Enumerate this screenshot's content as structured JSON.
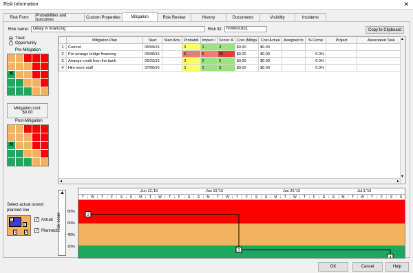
{
  "window": {
    "title": "Risk Information",
    "close": "✕"
  },
  "tabs": [
    {
      "label": "Risk Form",
      "active": false
    },
    {
      "label": "Probabilities and outcomes",
      "active": false
    },
    {
      "label": "Custom Properties",
      "active": false
    },
    {
      "label": "Mitigation",
      "active": true
    },
    {
      "label": "Risk Review",
      "active": false
    },
    {
      "label": "History",
      "active": false
    },
    {
      "label": "Documents",
      "active": false
    },
    {
      "label": "Visibility",
      "active": false
    },
    {
      "label": "Incidents",
      "active": false
    }
  ],
  "risk": {
    "name_label": "Risk name:",
    "name_value": "Delay in financing",
    "id_label": "Risk ID:",
    "id_value": "R00001831",
    "copy_button": "Copy to Clipboard"
  },
  "response": {
    "treat": "Treat",
    "opportunity": "Opportunity",
    "selected": "treat"
  },
  "pre_mitigation": {
    "title": "Pre-Mitigation",
    "cells": [
      [
        "orange",
        "orange",
        "red",
        "red",
        "red"
      ],
      [
        "orange",
        "orange",
        "orange",
        "red",
        "red"
      ],
      [
        "green",
        "orange",
        "orange",
        "red",
        "red"
      ],
      [
        "green",
        "green",
        "orange",
        "orange",
        "red"
      ],
      [
        "green",
        "green",
        "green",
        "orange",
        "orange"
      ]
    ],
    "marker": "✕"
  },
  "mitigation_cost": {
    "label": "Mitigation cost:",
    "value": "$0.00"
  },
  "post_mitigation": {
    "title": "Post-Mitigation",
    "cells": [
      [
        "orange",
        "orange",
        "red",
        "red",
        "red"
      ],
      [
        "orange",
        "orange",
        "orange",
        "red",
        "red"
      ],
      [
        "green",
        "orange",
        "orange",
        "red",
        "red"
      ],
      [
        "green",
        "green",
        "orange",
        "orange",
        "red"
      ],
      [
        "green",
        "green",
        "green",
        "orange",
        "orange"
      ]
    ],
    "marker": "✕"
  },
  "colors": {
    "red": "#ff0000",
    "orange": "#f4b25e",
    "green": "#1fa760",
    "yellow": "#ffff66",
    "lightgreen": "#9be37f",
    "salmon": "#f07b73",
    "darkred": "#e33a3a"
  },
  "table": {
    "headers": [
      "Mitigation Plan",
      "Start",
      "Start Actu",
      "Probabili",
      "Impact /",
      "Score: A",
      "Cost (Mitiga",
      "Cost Actual",
      "Assigned to",
      "% Comp",
      "Project",
      "Associated Task"
    ],
    "rows": [
      {
        "n": "1",
        "plan": "Current",
        "start": "05/09/16",
        "start_act": "",
        "prob": "3",
        "impact": "1",
        "score": "3",
        "cost": "$0.00",
        "cost_act": "$0.00",
        "assigned": "",
        "comp": "",
        "project": "",
        "task": "",
        "pc": "yellow",
        "ic": "lightgreen",
        "sc": "lightgreen"
      },
      {
        "n": "2",
        "plan": "Pre-arrange bridge financing",
        "start": "06/08/16",
        "start_act": "",
        "prob": "5",
        "impact": "5",
        "score": "25",
        "cost": "$0.00",
        "cost_act": "$0.00",
        "assigned": "",
        "comp": "0.0%",
        "project": "",
        "task": "",
        "pc": "salmon",
        "ic": "salmon",
        "sc": "darkred"
      },
      {
        "n": "3",
        "plan": "Arrange credit from the bank",
        "start": "06/22/16",
        "start_act": "",
        "prob": "3",
        "impact": "2",
        "score": "6",
        "cost": "$0.00",
        "cost_act": "$0.00",
        "assigned": "",
        "comp": "0.0%",
        "project": "",
        "task": "",
        "pc": "yellow",
        "ic": "lightgreen",
        "sc": "lightgreen"
      },
      {
        "n": "4",
        "plan": "Hire more staff",
        "start": "07/06/16",
        "start_act": "",
        "prob": "3",
        "impact": "1",
        "score": "3",
        "cost": "$0.00",
        "cost_act": "$0.00",
        "assigned": "",
        "comp": "0.0%",
        "project": "",
        "task": "",
        "pc": "yellow",
        "ic": "lightgreen",
        "sc": "lightgreen"
      }
    ]
  },
  "chart_options": {
    "select_label": "Select actual or/and planned line",
    "actual": "Actual",
    "planned": "Planned",
    "legend_top": "2",
    "legend_bottom": "1",
    "legend_mid": "2"
  },
  "gantt": {
    "axis_label": "Risk score",
    "weeks": [
      "Jun 12,'16",
      "Jun 19,'16",
      "Jun 26,'16",
      "Jul 3,'16"
    ],
    "days": [
      "T",
      "W",
      "T",
      "F",
      "S",
      "S",
      "M",
      "T",
      "W",
      "T",
      "F",
      "S",
      "S",
      "M",
      "T",
      "W",
      "T",
      "F",
      "S",
      "S",
      "M",
      "T",
      "W",
      "T",
      "F",
      "S",
      "S",
      "M",
      "T",
      "W",
      "T",
      "F",
      "S",
      "S"
    ],
    "y_ticks": [
      "80%",
      "60%",
      "40%",
      "20%"
    ],
    "points": [
      {
        "label": "2",
        "score": 0.76
      },
      {
        "label": "3",
        "score": 0.16
      },
      {
        "label": "4",
        "score": 0.04
      }
    ]
  },
  "buttons": {
    "ok": "OK",
    "cancel": "Cancel",
    "help": "Help"
  }
}
